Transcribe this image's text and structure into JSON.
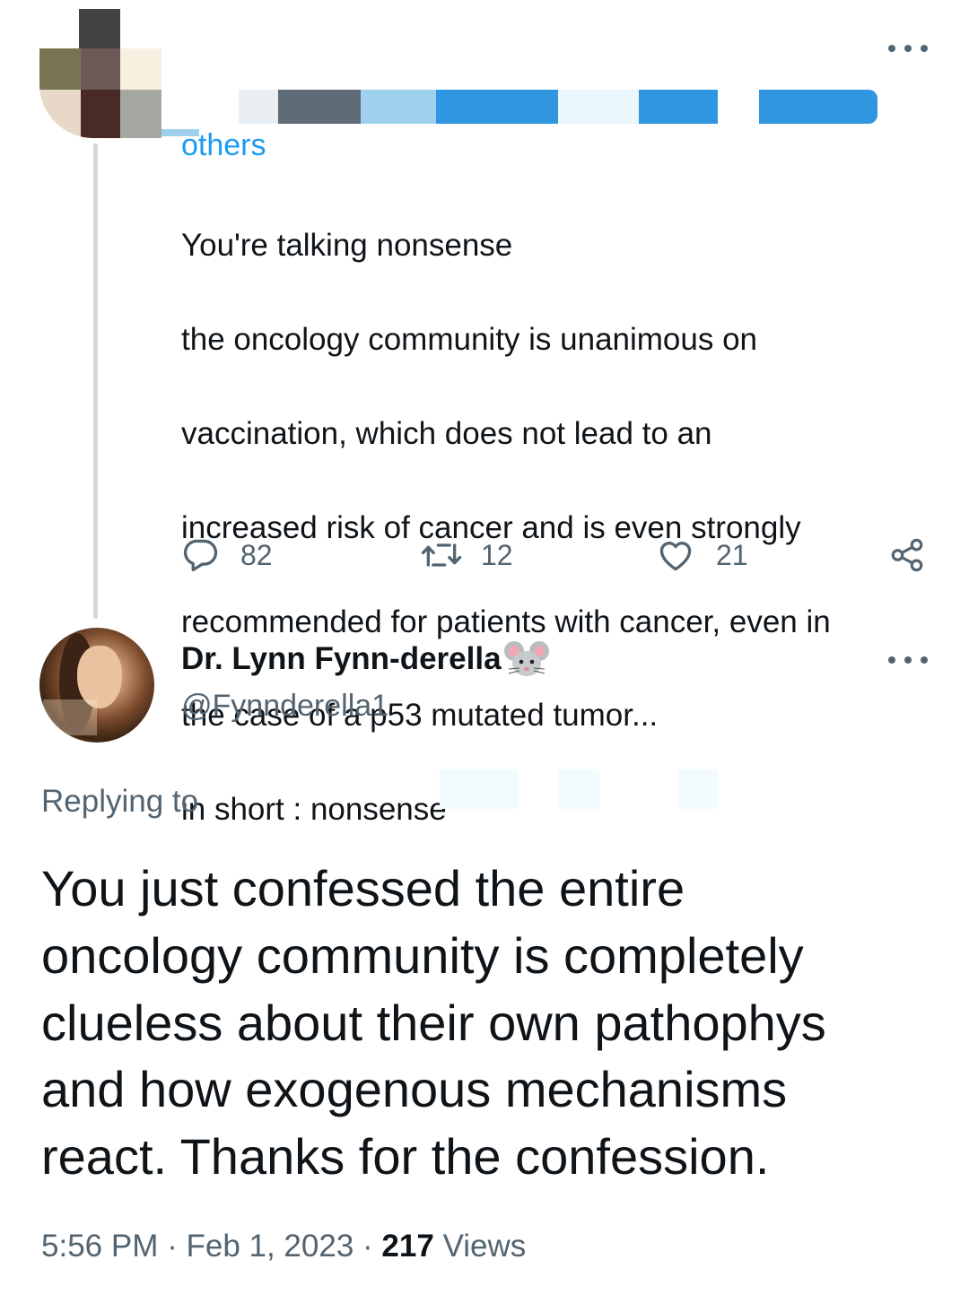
{
  "parent_tweet": {
    "others_link": "others",
    "text_lines": [
      "You're talking nonsense",
      "the oncology community is unanimous on",
      "vaccination, which does not lead to an",
      "increased risk of cancer and is even strongly",
      "recommended for patients with cancer, even in",
      "the case of a p53 mutated tumor...",
      "in short : nonsense"
    ],
    "replies": "82",
    "retweets": "12",
    "likes": "21"
  },
  "reply_tweet": {
    "display_name": "Dr. Lynn Fynn-derella",
    "handle": "@Fynnderella1",
    "replying_to": "Replying to",
    "text_lines": [
      "You just confessed the entire",
      "oncology community is completely",
      "clueless about their own pathophys",
      "and how exogenous mechanisms",
      "react. Thanks for the confession."
    ],
    "time": "5:56 PM",
    "separator": "·",
    "date": "Feb 1, 2023",
    "views_count": "217",
    "views_label": "Views"
  },
  "colors": {
    "link": "#1d9bf0",
    "secondary_text": "#536471",
    "primary_text": "#0f1419",
    "thread_line": "#cfd9de"
  },
  "icons": [
    "more-icon",
    "reply-icon",
    "retweet-icon",
    "like-icon",
    "share-icon",
    "mouse-emoji"
  ]
}
